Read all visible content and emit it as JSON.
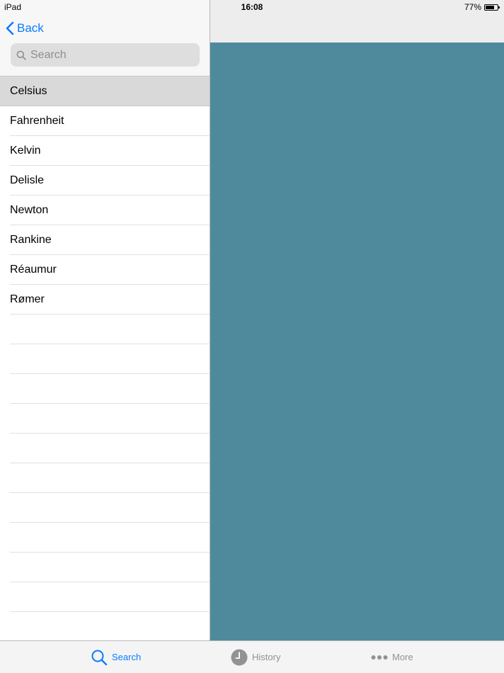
{
  "status_bar": {
    "device": "iPad",
    "time": "16:08",
    "battery": "77%",
    "battery_level": 0.77
  },
  "nav": {
    "back_label": "Back"
  },
  "search": {
    "placeholder": "Search"
  },
  "list": {
    "items": [
      {
        "label": "Celsius",
        "selected": true
      },
      {
        "label": "Fahrenheit"
      },
      {
        "label": "Kelvin"
      },
      {
        "label": "Delisle"
      },
      {
        "label": "Newton"
      },
      {
        "label": "Rankine"
      },
      {
        "label": "Réaumur"
      },
      {
        "label": "Rømer"
      }
    ],
    "empty_rows": 12
  },
  "tab_bar": {
    "tabs": [
      {
        "label": "Search",
        "icon": "search-icon",
        "active": true
      },
      {
        "label": "History",
        "icon": "clock-icon"
      },
      {
        "label": "More",
        "icon": "more-dots-icon"
      }
    ]
  },
  "colors": {
    "accent": "#0a7bff",
    "detail_background": "#4e8a9c",
    "selected_row": "#d9d9d9",
    "tab_inactive": "#929292"
  }
}
